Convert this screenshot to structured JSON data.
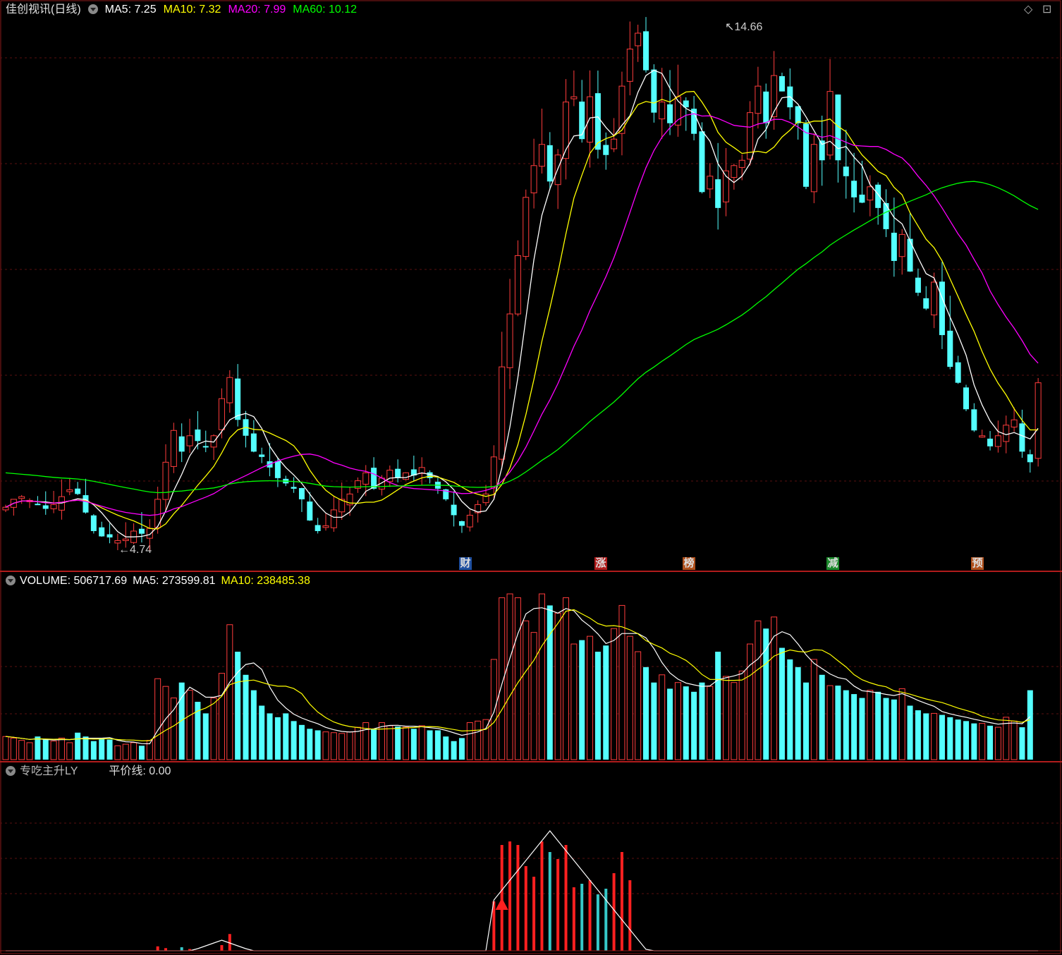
{
  "price_panel": {
    "title": "佳创视讯(日线)",
    "ma5_label": "MA5: 7.25",
    "ma10_label": "MA10: 7.32",
    "ma20_label": "MA20: 7.99",
    "ma60_label": "MA60: 10.12",
    "high_label": "14.66",
    "low_label": "4.74",
    "colors": {
      "ma5": "#ffffff",
      "ma10": "#ffff00",
      "ma20": "#ff00ff",
      "ma60": "#00ff00",
      "up": "#ff3c3c",
      "down": "#54ffff"
    }
  },
  "event_badges": [
    {
      "text": "财",
      "bg": "#1f4fa0"
    },
    {
      "text": "涨",
      "bg": "#b01c1c"
    },
    {
      "text": "榜",
      "bg": "#b0501c"
    },
    {
      "text": "减",
      "bg": "#1c8a2c"
    },
    {
      "text": "预",
      "bg": "#b0501c"
    }
  ],
  "volume_panel": {
    "volume_label": "VOLUME: 506717.69",
    "ma5_label": "MA5: 273599.81",
    "ma10_label": "MA10: 238485.38"
  },
  "indicator_panel": {
    "name": "专吃主升LY",
    "line_label": "平价线: 0.00"
  },
  "toolbar": {
    "diamond_icon": "◇",
    "expand_icon": "⊡"
  },
  "chart_data": {
    "type": "candlestick",
    "high": 14.66,
    "low": 4.74,
    "closes": [
      5.55,
      5.7,
      5.75,
      5.68,
      5.6,
      5.52,
      5.6,
      5.75,
      5.88,
      5.8,
      5.45,
      5.1,
      5.0,
      4.98,
      4.92,
      4.95,
      5.1,
      5.05,
      5.15,
      5.7,
      6.4,
      7.0,
      6.6,
      6.9,
      6.8,
      6.7,
      6.9,
      7.6,
      8.0,
      7.2,
      6.9,
      6.6,
      6.5,
      6.3,
      6.1,
      6.0,
      5.9,
      5.7,
      5.3,
      5.1,
      5.2,
      5.5,
      5.7,
      5.8,
      6.05,
      6.2,
      5.9,
      6.1,
      6.25,
      6.1,
      6.2,
      6.15,
      6.3,
      6.1,
      5.9,
      5.7,
      5.4,
      5.2,
      5.4,
      5.6,
      5.8,
      6.5,
      8.2,
      9.2,
      10.3,
      11.4,
      12.0,
      12.4,
      11.7,
      12.2,
      13.2,
      13.3,
      12.5,
      13.3,
      12.3,
      12.2,
      12.5,
      13.5,
      14.2,
      14.5,
      13.8,
      13.0,
      13.2,
      12.8,
      13.3,
      13.1,
      12.6,
      11.5,
      11.8,
      11.2,
      11.9,
      12.0,
      12.1,
      13.0,
      13.5,
      12.8,
      13.7,
      13.4,
      13.1,
      12.8,
      11.6,
      12.4,
      12.1,
      13.4,
      12.1,
      11.8,
      11.4,
      11.3,
      11.6,
      11.2,
      10.8,
      10.2,
      10.7,
      10.0,
      9.6,
      9.3,
      9.8,
      8.8,
      8.2,
      7.9,
      7.4,
      7.0,
      6.9,
      6.7,
      6.9,
      7.1,
      7.2,
      6.6,
      6.4,
      7.9
    ],
    "volume": [
      30,
      28,
      25,
      22,
      30,
      26,
      24,
      28,
      22,
      35,
      30,
      24,
      28,
      26,
      18,
      20,
      22,
      18,
      25,
      105,
      95,
      80,
      100,
      90,
      75,
      60,
      80,
      112,
      175,
      140,
      110,
      90,
      70,
      60,
      55,
      60,
      50,
      45,
      40,
      38,
      36,
      35,
      34,
      36,
      42,
      48,
      40,
      48,
      44,
      43,
      42,
      40,
      44,
      38,
      38,
      30,
      24,
      28,
      48,
      50,
      52,
      130,
      210,
      215,
      210,
      180,
      165,
      215,
      200,
      190,
      210,
      150,
      155,
      160,
      140,
      148,
      170,
      200,
      160,
      140,
      120,
      100,
      110,
      92,
      100,
      95,
      88,
      100,
      95,
      140,
      108,
      100,
      115,
      150,
      180,
      170,
      185,
      145,
      130,
      120,
      100,
      130,
      110,
      96,
      96,
      90,
      85,
      80,
      90,
      88,
      80,
      78,
      92,
      70,
      64,
      60,
      60,
      58,
      55,
      52,
      50,
      47,
      47,
      44,
      42,
      55,
      50,
      42,
      90
    ]
  }
}
